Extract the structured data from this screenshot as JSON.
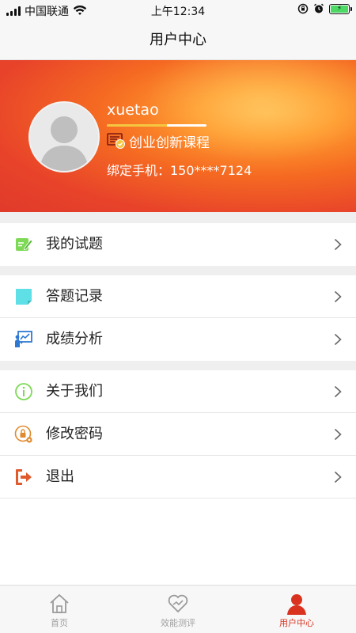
{
  "status_bar": {
    "carrier": "中国联通",
    "time": "上午12:34",
    "battery_fill": 1.0
  },
  "nav": {
    "title": "用户中心"
  },
  "profile": {
    "username": "xuetao",
    "level_progress": 0.6,
    "course": "创业创新课程",
    "phone_label": "绑定手机：150****7124"
  },
  "menu": {
    "my_questions": {
      "label": "我的试题",
      "icon": "edit-icon"
    },
    "answer_records": {
      "label": "答题记录",
      "icon": "note-icon"
    },
    "score_analysis": {
      "label": "成绩分析",
      "icon": "presentation-chart-icon"
    },
    "about_us": {
      "label": "关于我们",
      "icon": "info-icon"
    },
    "change_password": {
      "label": "修改密码",
      "icon": "lock-gear-icon"
    },
    "logout": {
      "label": "退出",
      "icon": "logout-icon"
    }
  },
  "tabs": {
    "home": {
      "label": "首页",
      "icon": "house-icon"
    },
    "evaluation": {
      "label": "效能测评",
      "icon": "heart-hands-icon"
    },
    "user_center": {
      "label": "用户中心",
      "icon": "person-icon"
    },
    "active": "user_center"
  },
  "colors": {
    "accent": "#d9331f",
    "banner_orange": "#f56a22",
    "banner_red": "#e03a2b",
    "menu_icon_green": "#7ed957",
    "menu_icon_cyan": "#5fe0e6",
    "menu_icon_blue": "#2f78d1",
    "menu_icon_orange": "#e08a2e",
    "logout_icon": "#e05a2b"
  }
}
